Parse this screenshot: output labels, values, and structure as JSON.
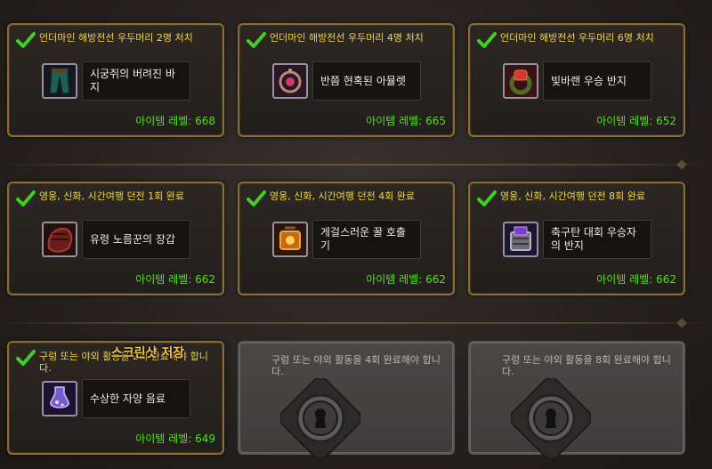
{
  "cards": [
    {
      "req": "언더마인 해방전선 우두머리 2명 처치",
      "item": "시궁쥐의 버려진 바지",
      "ilvl": "아이템 레벨: 668",
      "icon": "pants-icon"
    },
    {
      "req": "언더마인 해방전선 우두머리 4명 처치",
      "item": "반쯤 현혹된 아뮬렛",
      "ilvl": "아이템 레벨: 665",
      "icon": "amulet-icon"
    },
    {
      "req": "언더마인 해방전선 우두머리 6명 처치",
      "item": "빛바랜 우승 반지",
      "ilvl": "아이템 레벨: 652",
      "icon": "ring-icon"
    },
    {
      "req": "영웅, 신화, 시간여행 던전 1회 완료",
      "item": "유령 노름꾼의 장갑",
      "ilvl": "아이템 레벨: 662",
      "icon": "gloves-icon"
    },
    {
      "req": "영웅, 신화, 시간여행 던전 4회 완료",
      "item": "게걸스러운 꿀 호출기",
      "ilvl": "아이템 레벨: 662",
      "icon": "honey-caller-icon"
    },
    {
      "req": "영웅, 신화, 시간여행 던전 8회 완료",
      "item": "축구탄 대회 우승자의 반지",
      "ilvl": "아이템 레벨: 662",
      "icon": "champion-ring-icon"
    },
    {
      "req": "구렁 또는 야외 활동을 2회 완료해야 합니다.",
      "item": "수상한 자양 음료",
      "ilvl": "아이템 레벨: 649",
      "icon": "tonic-icon"
    }
  ],
  "locked": [
    {
      "req": "구렁 또는 야외 활동을 4회 완료해야 합니다.",
      "icon": "keyhole-lock-icon"
    },
    {
      "req": "구렁 또는 야외 활동을 8회 완료해야 합니다.",
      "icon": "keyhole-lock-icon"
    }
  ],
  "watermark": "스크린샷 저장",
  "colors": {
    "requirement": "#f1d54a",
    "item_level": "#52e01d",
    "check": "#3fcf26",
    "border": "#8a6c35"
  }
}
